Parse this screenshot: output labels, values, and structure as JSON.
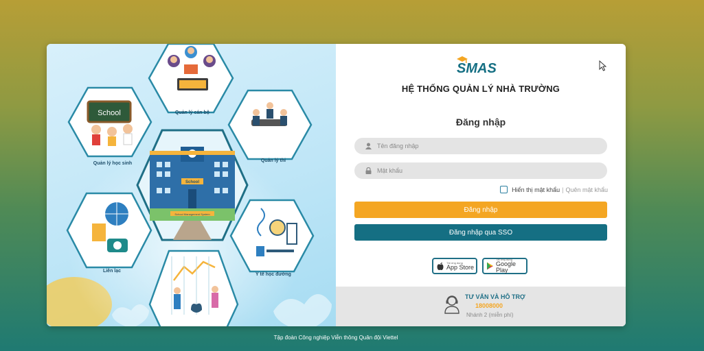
{
  "brand": {
    "logo_text": "SMAS",
    "system_title": "HỆ THỐNG QUẢN LÝ NHÀ TRƯỜNG"
  },
  "illustration": {
    "labels": {
      "staff": "Quản lý cán bộ",
      "students": "Quản lý học sinh",
      "exams": "Quản lý thi",
      "school_sign": "School",
      "board_text": "School",
      "system_banner": "School Management System",
      "contact": "Liên lạc",
      "health": "Y tế học đường"
    }
  },
  "login": {
    "heading": "Đăng nhập",
    "username_placeholder": "Tên đăng nhập",
    "password_placeholder": "Mật khẩu",
    "show_password_label": "Hiển thị mật khẩu",
    "separator": "|",
    "forgot_password": "Quên mật khẩu",
    "login_button": "Đăng nhập",
    "sso_button": "Đăng nhập qua SSO"
  },
  "stores": [
    {
      "small": "Tải ứng dụng",
      "name": "App Store",
      "icon": "apple-icon"
    },
    {
      "small": "Tải ứng dụng",
      "name": "Google Play",
      "icon": "google-play-icon"
    }
  ],
  "support": {
    "title": "TƯ VẤN VÀ HỖ TRỢ",
    "phone": "18008000",
    "note": "Nhánh 2 (miễn phí)"
  },
  "footer": {
    "text": "Tập đoàn Công nghiệp Viễn thông Quân đội Viettel"
  },
  "colors": {
    "accent_orange": "#f4a623",
    "teal": "#156f83",
    "hex_border": "#2a8aa6"
  }
}
